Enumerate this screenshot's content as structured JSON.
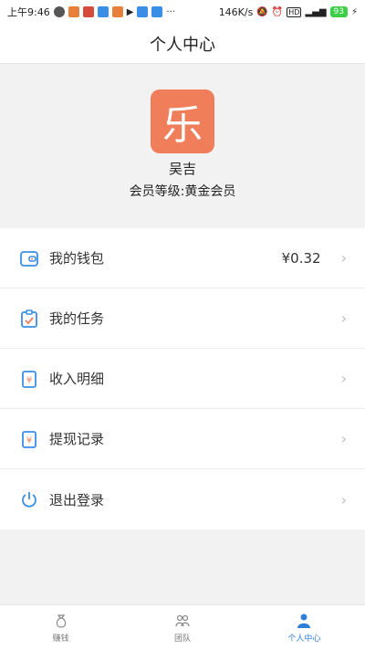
{
  "status_bar": {
    "time": "上午9:46",
    "network_speed": "146K/s",
    "battery": "93"
  },
  "header": {
    "title": "个人中心"
  },
  "profile": {
    "avatar_char": "乐",
    "name": "吴吉",
    "level": "会员等级:黄金会员"
  },
  "menu": {
    "items": [
      {
        "label": "我的钱包",
        "value": "¥0.32"
      },
      {
        "label": "我的任务"
      },
      {
        "label": "收入明细"
      },
      {
        "label": "提现记录"
      },
      {
        "label": "退出登录"
      }
    ]
  },
  "tabs": [
    {
      "label": "赚钱",
      "icon": "money-bag-icon"
    },
    {
      "label": "团队",
      "icon": "team-icon"
    },
    {
      "label": "个人中心",
      "icon": "person-icon"
    }
  ],
  "colors": {
    "accent": "#2f7fd9",
    "avatar_bg": "#f07e5b",
    "icon_blue": "#3a8ee6",
    "icon_orange": "#f07e5b"
  }
}
